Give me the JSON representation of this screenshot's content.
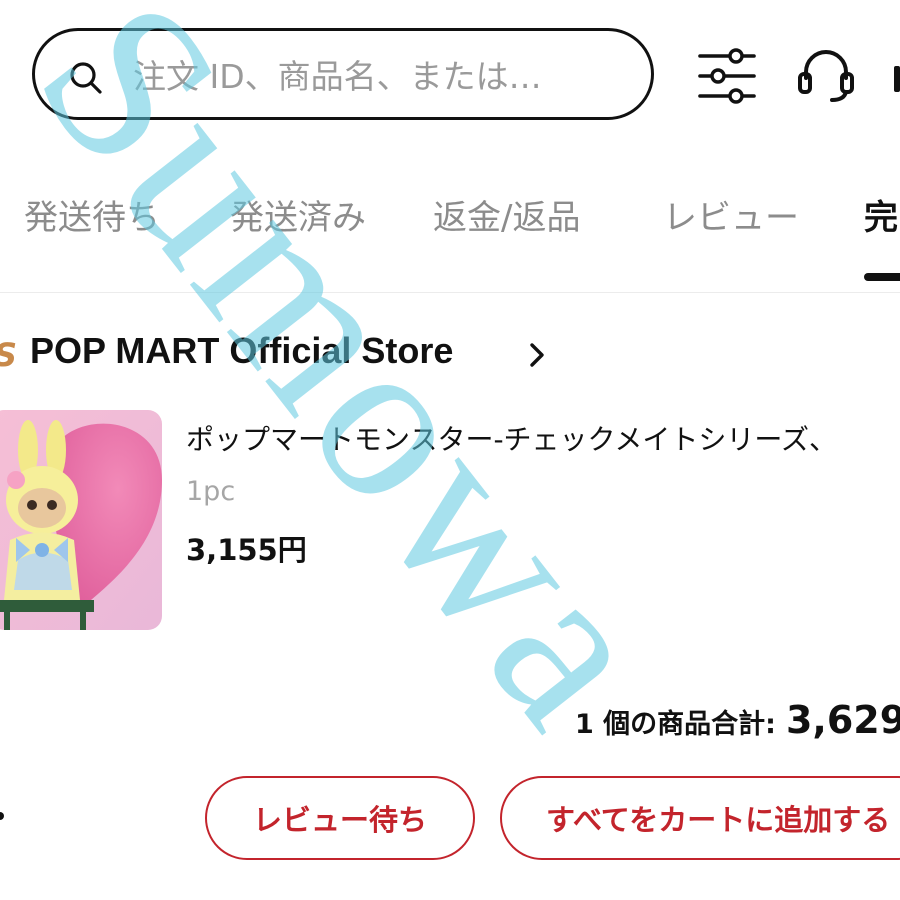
{
  "search": {
    "placeholder": "注文 ID、商品名、または…"
  },
  "icons": {
    "search": "search-icon",
    "filter": "sliders-icon",
    "support": "headset-icon"
  },
  "tabs": [
    {
      "label": "発送待ち"
    },
    {
      "label": "発送済み"
    },
    {
      "label": "返金/返品"
    },
    {
      "label": "レビュー"
    },
    {
      "label": "完"
    }
  ],
  "store": {
    "logo_fragment": "S",
    "name": "POP MART Official Store"
  },
  "product": {
    "title": "ポップマートモンスター-チェックメイトシリーズ、",
    "quantity": "1pc",
    "price": "3,155円"
  },
  "summary": {
    "label": "1 個の商品合計:",
    "total": "3,629"
  },
  "buttons": {
    "review": "レビュー待ち",
    "add_all": "すべてをカートに追加する"
  },
  "watermark": {
    "text": "Sumowa"
  },
  "colors": {
    "accent": "#c3242c",
    "watermark": "#5ec8e0"
  }
}
